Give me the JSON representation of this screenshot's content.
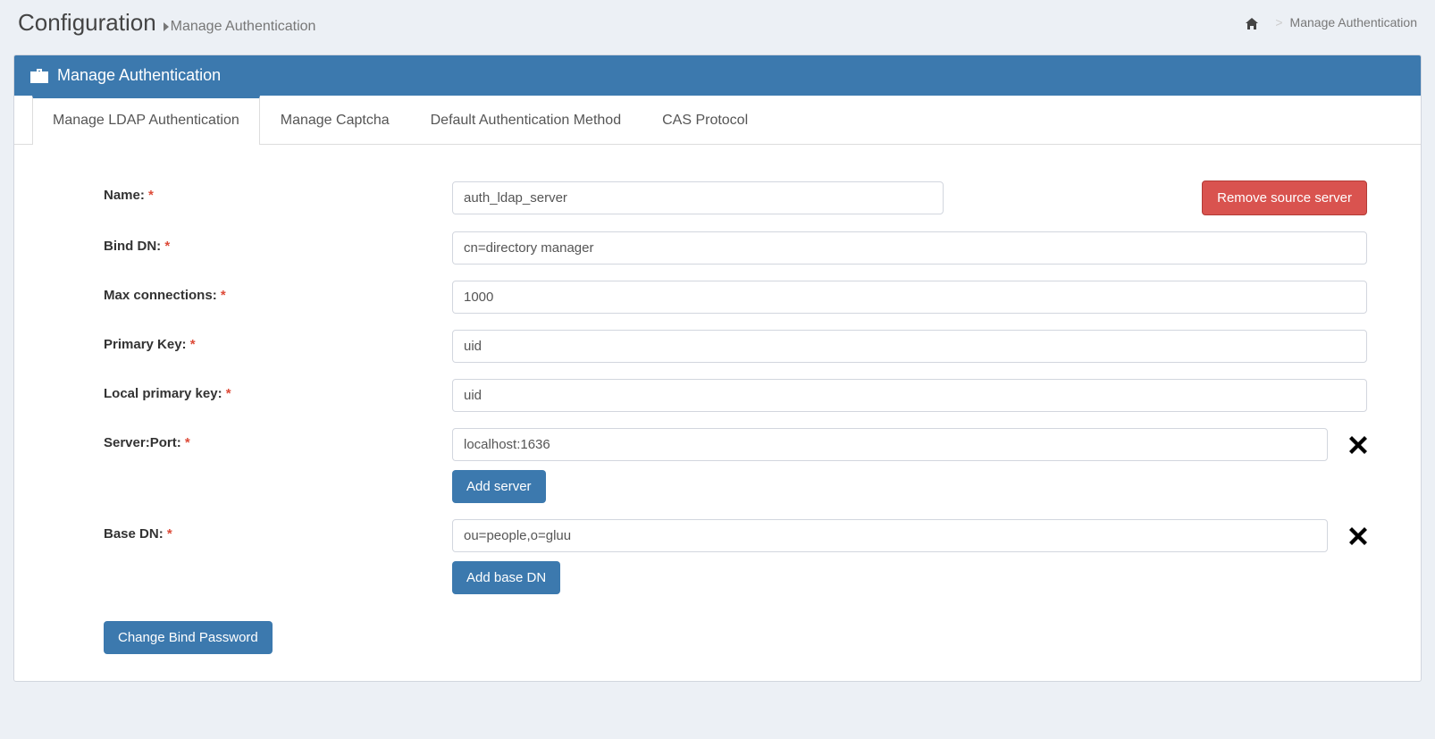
{
  "header": {
    "title": "Configuration",
    "subtitle": "Manage Authentication"
  },
  "breadcrumb": {
    "home_aria": "Home",
    "active": "Manage Authentication"
  },
  "panel": {
    "title": "Manage Authentication"
  },
  "tabs": [
    {
      "label": "Manage LDAP Authentication",
      "active": true
    },
    {
      "label": "Manage Captcha",
      "active": false
    },
    {
      "label": "Default Authentication Method",
      "active": false
    },
    {
      "label": "CAS Protocol",
      "active": false
    }
  ],
  "form": {
    "name_label": "Name:",
    "name_value": "auth_ldap_server",
    "remove_server_label": "Remove source server",
    "bind_dn_label": "Bind DN:",
    "bind_dn_value": "cn=directory manager",
    "max_conn_label": "Max connections:",
    "max_conn_value": "1000",
    "primary_key_label": "Primary Key:",
    "primary_key_value": "uid",
    "local_primary_key_label": "Local primary key:",
    "local_primary_key_value": "uid",
    "server_port_label": "Server:Port:",
    "server_port_value": "localhost:1636",
    "add_server_label": "Add server",
    "base_dn_label": "Base DN:",
    "base_dn_value": "ou=people,o=gluu",
    "add_base_dn_label": "Add base DN",
    "change_bind_pw_label": "Change Bind Password"
  }
}
